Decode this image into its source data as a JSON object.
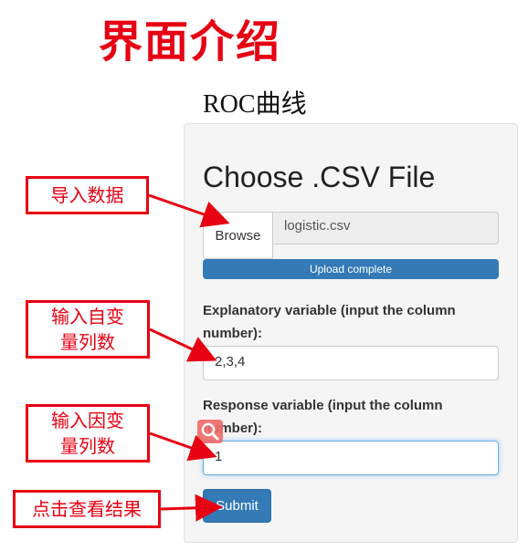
{
  "page_title": "界面介绍",
  "section_title": "ROC曲线",
  "panel": {
    "heading": "Choose .CSV File",
    "browse_label": "Browse",
    "file_name": "logistic.csv",
    "progress_label": "Upload complete",
    "progress_percent": 100,
    "explanatory_label": "Explanatory variable (input the column number):",
    "explanatory_value": "2,3,4",
    "response_label": "Response variable (input the column number):",
    "response_value": "1",
    "submit_label": "Submit"
  },
  "callouts": {
    "import": "导入数据",
    "explanatory_line1": "输入自变",
    "explanatory_line2": "量列数",
    "response_line1": "输入因变",
    "response_line2": "量列数",
    "submit": "点击查看结果"
  },
  "colors": {
    "accent_red": "#e60012",
    "primary_blue": "#337ab7"
  },
  "icons": [
    "search-icon"
  ]
}
